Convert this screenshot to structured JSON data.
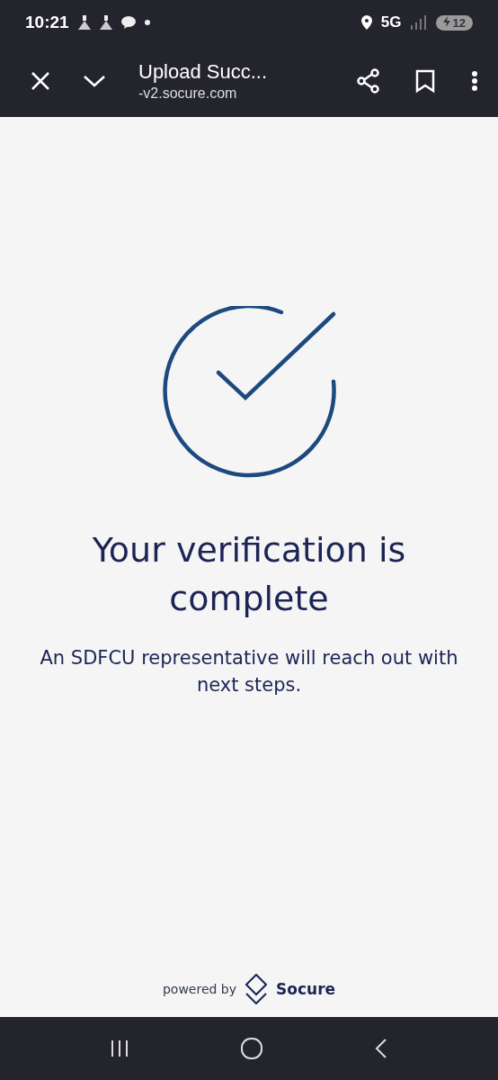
{
  "status_bar": {
    "time": "10:21",
    "network": "5G",
    "battery": "12"
  },
  "browser_toolbar": {
    "title": "Upload Succ...",
    "url": "-v2.socure.com"
  },
  "page": {
    "heading": "Your verification is complete",
    "message": "An SDFCU representative will reach out with next steps."
  },
  "footer": {
    "prefix": "powered by",
    "brand": "Socure"
  }
}
